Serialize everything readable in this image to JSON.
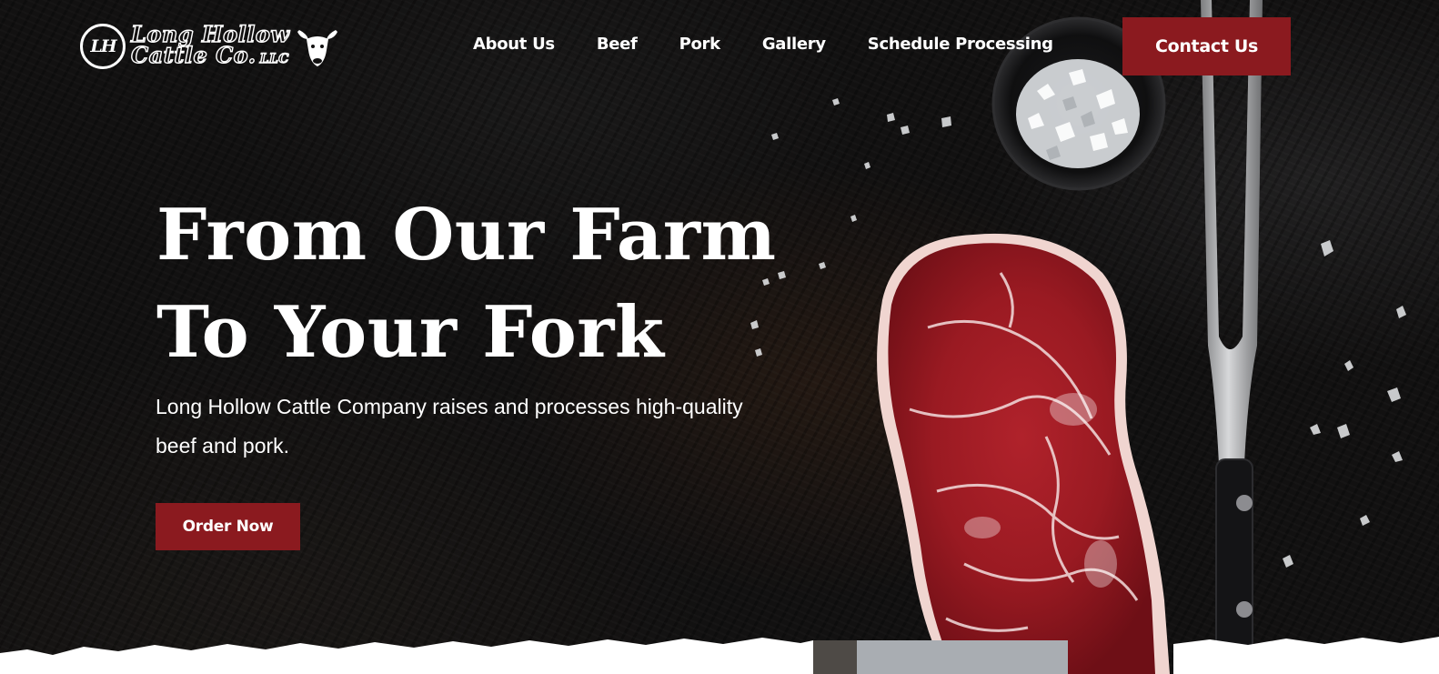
{
  "brand": {
    "logo_initials": "LH",
    "logo_line1": "Long Hollow",
    "logo_line2": "Cattle Co.",
    "logo_suffix": "LLC",
    "logo_icon": "bull-head-icon"
  },
  "nav": {
    "items": [
      {
        "label": "About Us"
      },
      {
        "label": "Beef"
      },
      {
        "label": "Pork"
      },
      {
        "label": "Gallery"
      },
      {
        "label": "Schedule Processing"
      }
    ],
    "contact_label": "Contact Us"
  },
  "hero": {
    "headline_line1": "From Our Farm",
    "headline_line2": "To Your Fork",
    "subtext": "Long Hollow Cattle Company raises and processes high-quality beef and pork.",
    "cta_label": "Order Now"
  },
  "colors": {
    "accent": "#8b1a1f",
    "background": "#121111",
    "text": "#ffffff"
  }
}
